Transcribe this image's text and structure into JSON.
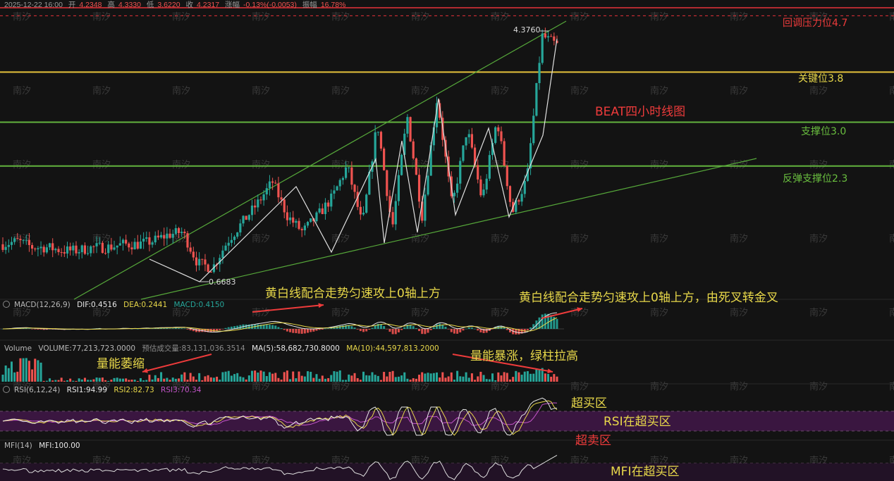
{
  "header": {
    "datetime": "2025-12-22 16:00",
    "open_label": "开",
    "open": "4.2348",
    "high_label": "高",
    "high": "4.3330",
    "low_label": "低",
    "low": "3.6220",
    "close_label": "收",
    "close": "4.2317",
    "change_label": "涨幅",
    "change": "-0.13%(-0.0053)",
    "amplitude_label": "振幅",
    "amplitude": "16.78%"
  },
  "colors": {
    "up": "#26a69a",
    "down": "#ef5350",
    "level_red": "#e8333a",
    "level_yellow": "#e5c13b",
    "level_green": "#63b33e",
    "ann_yellow": "#e8d84a",
    "ann_red": "#ee3b3b",
    "rsi_yellow": "#e8d84a",
    "rsi_purple": "#c254c8",
    "overbought_band": "#3a1640"
  },
  "levels": [
    {
      "label": "回调压力位4.7",
      "color": "#ee3b3b"
    },
    {
      "label": "关键位3.8",
      "color": "#e8d84a"
    },
    {
      "label": "支撑位3.0",
      "color": "#6abf3f"
    },
    {
      "label": "反弹支撑位2.3",
      "color": "#6abf3f"
    }
  ],
  "annotations": {
    "title": "BEAT四小时线图",
    "high_marker": "4.3760",
    "low_marker": "0.6683",
    "macd_note_left": "黄白线配合走势匀速攻上0轴上方",
    "macd_note_right": "黄白线配合走势匀速攻上0轴上方，由死叉转金叉",
    "volume_note_left": "量能萎缩",
    "volume_note_right": "量能暴涨，绿柱拉高",
    "rsi_overbought": "超买区",
    "rsi_note": "RSI在超买区",
    "rsi_oversold": "超卖区",
    "mfi_note": "MFI在超买区",
    "watermark": "南汐"
  },
  "indicators": {
    "macd": {
      "name": "MACD(12,26,9)",
      "dif": "DIF:0.4516",
      "dea": "DEA:0.2441",
      "macd": "MACD:0.4150"
    },
    "volume": {
      "name": "Volume",
      "volume": "VOLUME:77,213,723.0000",
      "forecast": "预估成交量:83,131,036.3514",
      "ma5": "MA(5):58,682,730.8000",
      "ma10": "MA(10):44,597,813.2000"
    },
    "rsi": {
      "name": "RSI(6,12,24)",
      "rsi1": "RSI1:94.99",
      "rsi2": "RSI2:82.73",
      "rsi3": "RSI3:70.34"
    },
    "mfi": {
      "name": "MFI(14)",
      "mfi": "MFI:100.00"
    }
  },
  "chart_data": {
    "type": "candlestick",
    "title": "BEAT四小时线图",
    "ylim": [
      0.2,
      5.0
    ],
    "horizontal_levels": [
      4.7,
      3.8,
      3.0,
      2.3
    ],
    "swing_points": [
      {
        "label": "low",
        "value": 0.6683
      },
      {
        "label": "high",
        "value": 4.376
      }
    ],
    "close_path": [
      1.05,
      1.1,
      1.0,
      1.0,
      0.95,
      0.95,
      1.0,
      1.0,
      1.05,
      1.05,
      1.1,
      1.2,
      1.25,
      0.75,
      0.67,
      1.1,
      1.4,
      1.7,
      2.05,
      1.5,
      1.25,
      1.5,
      1.8,
      2.3,
      1.35,
      3.0,
      1.3,
      3.1,
      1.5,
      3.4,
      1.65,
      2.9,
      1.75,
      3.05,
      1.55,
      2.1,
      4.38,
      4.23
    ],
    "macd": {
      "dif": 0.4516,
      "dea": 0.2441,
      "macd": 0.415
    },
    "volume": {
      "volume": 77213723.0,
      "forecast": 83131036.3514,
      "ma5": 58682730.8,
      "ma10": 44597813.2
    },
    "rsi": {
      "rsi1": 94.99,
      "rsi2": 82.73,
      "rsi3": 70.34
    },
    "mfi": 100.0
  }
}
